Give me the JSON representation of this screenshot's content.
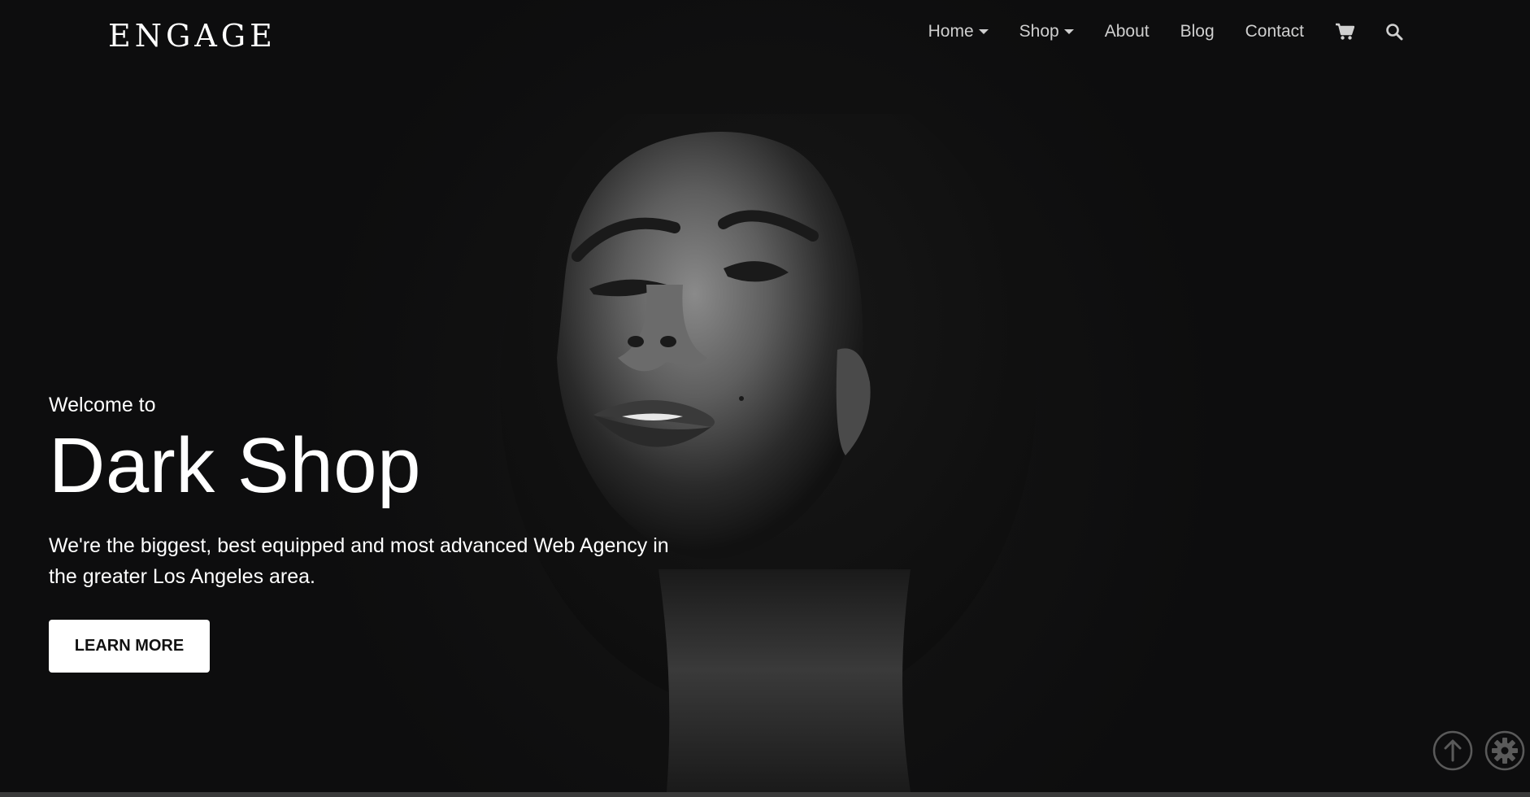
{
  "brand": {
    "logo_text": "ENGAGE"
  },
  "nav": {
    "items": [
      {
        "label": "Home",
        "has_dropdown": true
      },
      {
        "label": "Shop",
        "has_dropdown": true
      },
      {
        "label": "About",
        "has_dropdown": false
      },
      {
        "label": "Blog",
        "has_dropdown": false
      },
      {
        "label": "Contact",
        "has_dropdown": false
      }
    ],
    "icons": [
      "cart-icon",
      "search-icon"
    ]
  },
  "hero": {
    "eyebrow": "Welcome to",
    "headline": "Dark Shop",
    "description": "We're the biggest, best equipped and most advanced Web Agency in the greater Los Angeles area.",
    "cta_label": "LEARN MORE",
    "image": "black-and-white-portrait-face"
  },
  "floating_buttons": [
    "arrow-up-icon",
    "gear-icon"
  ],
  "colors": {
    "background": "#0d0d0e",
    "text": "#ffffff",
    "nav_text": "#cfcfcf",
    "button_bg": "#ffffff",
    "button_text": "#111111",
    "float_icon": "#5a5a5a"
  }
}
